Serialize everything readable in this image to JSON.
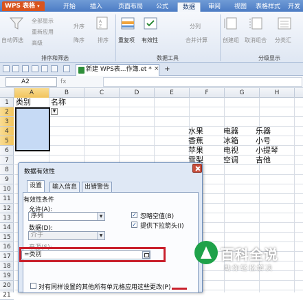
{
  "app": {
    "name": "WPS 表格"
  },
  "ribbon_tabs": [
    {
      "label": "开始"
    },
    {
      "label": "插入"
    },
    {
      "label": "页面布局"
    },
    {
      "label": "公式"
    },
    {
      "label": "数据"
    },
    {
      "label": "审阅"
    },
    {
      "label": "视图"
    },
    {
      "label": "表格样式"
    },
    {
      "label": "开发"
    }
  ],
  "active_tab": "数据",
  "ribbon": {
    "auto_filter": "自动筛选",
    "show_all": "全部显示",
    "reapply": "重新应用",
    "advanced": "高级",
    "sort_asc": "升序",
    "sort_desc": "降序",
    "sort": "排序",
    "remove_duplicates": "重复项",
    "validation": "有效性",
    "split": "分列",
    "merge_calc": "合并计算",
    "create_group": "创建组",
    "ungroup": "取消组合",
    "subtotal": "分类汇",
    "group_sort_filter": "排序和筛选",
    "group_data_tools": "数据工具",
    "group_outline": "分级显示"
  },
  "document": {
    "tab_title": "新建 WPS表...作簿.et *",
    "close": "×",
    "add": "+"
  },
  "formula_bar": {
    "name_box": "A2",
    "fx": "fx"
  },
  "columns": [
    "A",
    "B",
    "C",
    "D",
    "E",
    "F",
    "G",
    "H"
  ],
  "rows": [
    "1",
    "2",
    "3",
    "4",
    "5",
    "6",
    "7",
    "8",
    "9",
    "10",
    "11",
    "12",
    "13",
    "14",
    "15",
    "16",
    "17",
    "18",
    "19",
    "20",
    "21"
  ],
  "cells": {
    "A1": "类别",
    "B1": "名称",
    "F4": "水果",
    "G4": "电器",
    "H4": "乐器",
    "F5": "香蕉",
    "G5": "冰箱",
    "H5": "小号",
    "F6": "苹果",
    "G6": "电视",
    "H6": "小提琴",
    "F7": "雪梨",
    "G7": "空调",
    "H7": "吉他"
  },
  "dialog": {
    "title": "数据有效性",
    "tabs": [
      {
        "label": "设置"
      },
      {
        "label": "输入信息"
      },
      {
        "label": "出错警告"
      }
    ],
    "criteria_heading": "有效性条件",
    "allow_label": "允许(A):",
    "allow_value": "序列",
    "ignore_blank": "忽略空值(B)",
    "dropdown_arrow": "提供下拉箭头(I)",
    "data_label": "数据(D):",
    "data_value": "介于",
    "source_label": "来源(S):",
    "source_value": "=类别",
    "apply_all": "对有同样设置的其他所有单元格应用这些更改(P)"
  },
  "watermark": {
    "title": "百科全说",
    "subtitle": "助你轻松解决"
  },
  "colors": {
    "accent": "#4c7cc4",
    "selection": "#c6daf5",
    "highlight": "#c9202c",
    "brand_green": "#1fa24a"
  }
}
